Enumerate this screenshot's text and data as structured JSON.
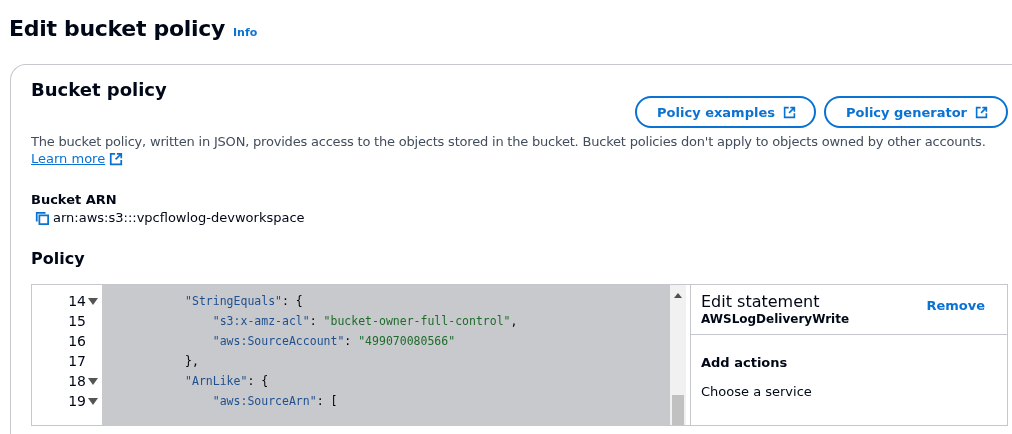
{
  "page": {
    "title": "Edit bucket policy",
    "info_link": "Info"
  },
  "panel": {
    "title": "Bucket policy",
    "buttons": [
      {
        "label": "Policy examples"
      },
      {
        "label": "Policy generator"
      }
    ],
    "description": "The bucket policy, written in JSON, provides access to the objects stored in the bucket. Bucket policies don't apply to objects owned by other accounts.",
    "learn_more": "Learn more",
    "arn_label": "Bucket ARN",
    "arn_value": "arn:aws:s3:::vpcflowlog-devworkspace",
    "policy_heading": "Policy"
  },
  "editor": {
    "lines": [
      {
        "number": "14",
        "foldable": true,
        "tokens": [
          {
            "kind": "key",
            "text": "            \"StringEquals\""
          },
          {
            "kind": "plain",
            "text": ": {"
          }
        ]
      },
      {
        "number": "15",
        "foldable": false,
        "tokens": [
          {
            "kind": "key",
            "text": "                \"s3:x-amz-acl\""
          },
          {
            "kind": "plain",
            "text": ": "
          },
          {
            "kind": "string",
            "text": "\"bucket-owner-full-control\""
          },
          {
            "kind": "plain",
            "text": ","
          }
        ]
      },
      {
        "number": "16",
        "foldable": false,
        "tokens": [
          {
            "kind": "key",
            "text": "                \"aws:SourceAccount\""
          },
          {
            "kind": "plain",
            "text": ": "
          },
          {
            "kind": "string",
            "text": "\"499070080566\""
          }
        ]
      },
      {
        "number": "17",
        "foldable": false,
        "tokens": [
          {
            "kind": "plain",
            "text": "            },"
          }
        ]
      },
      {
        "number": "18",
        "foldable": true,
        "tokens": [
          {
            "kind": "key",
            "text": "            \"ArnLike\""
          },
          {
            "kind": "plain",
            "text": ": {"
          }
        ]
      },
      {
        "number": "19",
        "foldable": true,
        "tokens": [
          {
            "kind": "key",
            "text": "                \"aws:SourceArn\""
          },
          {
            "kind": "plain",
            "text": ": ["
          }
        ]
      }
    ]
  },
  "statement": {
    "title": "Edit statement",
    "name": "AWSLogDeliveryWrite",
    "remove": "Remove",
    "section": "Add actions",
    "field_label": "Choose a service"
  }
}
